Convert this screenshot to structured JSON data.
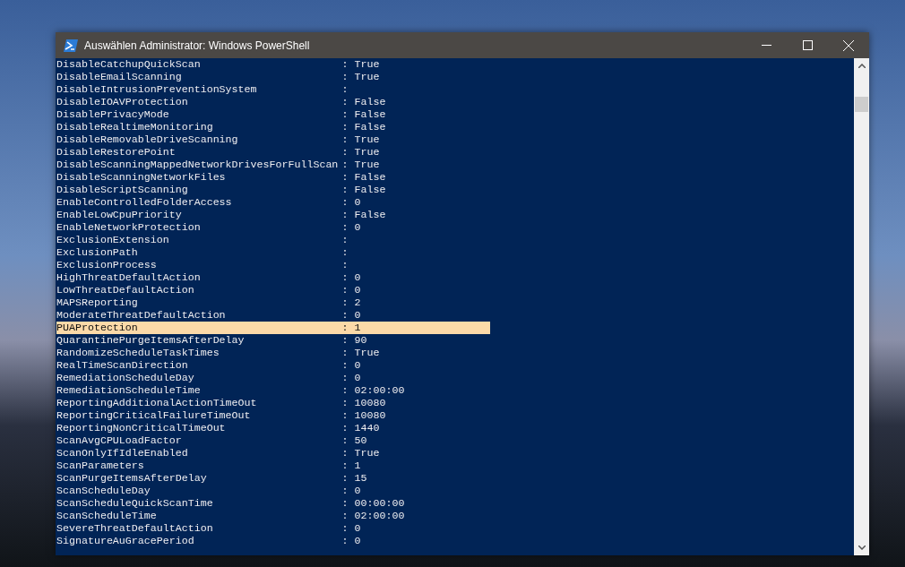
{
  "window": {
    "title": "Auswählen Administrator: Windows PowerShell"
  },
  "rows": [
    {
      "name": "DisableCatchupQuickScan",
      "value": ": True",
      "selected": false
    },
    {
      "name": "DisableEmailScanning",
      "value": ": True",
      "selected": false
    },
    {
      "name": "DisableIntrusionPreventionSystem",
      "value": ":",
      "selected": false
    },
    {
      "name": "DisableIOAVProtection",
      "value": ": False",
      "selected": false
    },
    {
      "name": "DisablePrivacyMode",
      "value": ": False",
      "selected": false
    },
    {
      "name": "DisableRealtimeMonitoring",
      "value": ": False",
      "selected": false
    },
    {
      "name": "DisableRemovableDriveScanning",
      "value": ": True",
      "selected": false
    },
    {
      "name": "DisableRestorePoint",
      "value": ": True",
      "selected": false
    },
    {
      "name": "DisableScanningMappedNetworkDrivesForFullScan",
      "value": ": True",
      "selected": false
    },
    {
      "name": "DisableScanningNetworkFiles",
      "value": ": False",
      "selected": false
    },
    {
      "name": "DisableScriptScanning",
      "value": ": False",
      "selected": false
    },
    {
      "name": "EnableControlledFolderAccess",
      "value": ": 0",
      "selected": false
    },
    {
      "name": "EnableLowCpuPriority",
      "value": ": False",
      "selected": false
    },
    {
      "name": "EnableNetworkProtection",
      "value": ": 0",
      "selected": false
    },
    {
      "name": "ExclusionExtension",
      "value": ":",
      "selected": false
    },
    {
      "name": "ExclusionPath",
      "value": ":",
      "selected": false
    },
    {
      "name": "ExclusionProcess",
      "value": ":",
      "selected": false
    },
    {
      "name": "HighThreatDefaultAction",
      "value": ": 0",
      "selected": false
    },
    {
      "name": "LowThreatDefaultAction",
      "value": ": 0",
      "selected": false
    },
    {
      "name": "MAPSReporting",
      "value": ": 2",
      "selected": false
    },
    {
      "name": "ModerateThreatDefaultAction",
      "value": ": 0",
      "selected": false
    },
    {
      "name": "PUAProtection",
      "value": ": 1",
      "selected": true
    },
    {
      "name": "QuarantinePurgeItemsAfterDelay",
      "value": ": 90",
      "selected": false
    },
    {
      "name": "RandomizeScheduleTaskTimes",
      "value": ": True",
      "selected": false
    },
    {
      "name": "RealTimeScanDirection",
      "value": ": 0",
      "selected": false
    },
    {
      "name": "RemediationScheduleDay",
      "value": ": 0",
      "selected": false
    },
    {
      "name": "RemediationScheduleTime",
      "value": ": 02:00:00",
      "selected": false
    },
    {
      "name": "ReportingAdditionalActionTimeOut",
      "value": ": 10080",
      "selected": false
    },
    {
      "name": "ReportingCriticalFailureTimeOut",
      "value": ": 10080",
      "selected": false
    },
    {
      "name": "ReportingNonCriticalTimeOut",
      "value": ": 1440",
      "selected": false
    },
    {
      "name": "ScanAvgCPULoadFactor",
      "value": ": 50",
      "selected": false
    },
    {
      "name": "ScanOnlyIfIdleEnabled",
      "value": ": True",
      "selected": false
    },
    {
      "name": "ScanParameters",
      "value": ": 1",
      "selected": false
    },
    {
      "name": "ScanPurgeItemsAfterDelay",
      "value": ": 15",
      "selected": false
    },
    {
      "name": "ScanScheduleDay",
      "value": ": 0",
      "selected": false
    },
    {
      "name": "ScanScheduleQuickScanTime",
      "value": ": 00:00:00",
      "selected": false
    },
    {
      "name": "ScanScheduleTime",
      "value": ": 02:00:00",
      "selected": false
    },
    {
      "name": "SevereThreatDefaultAction",
      "value": ": 0",
      "selected": false
    },
    {
      "name": "SignatureAuGracePeriod",
      "value": ": 0",
      "selected": false
    }
  ]
}
